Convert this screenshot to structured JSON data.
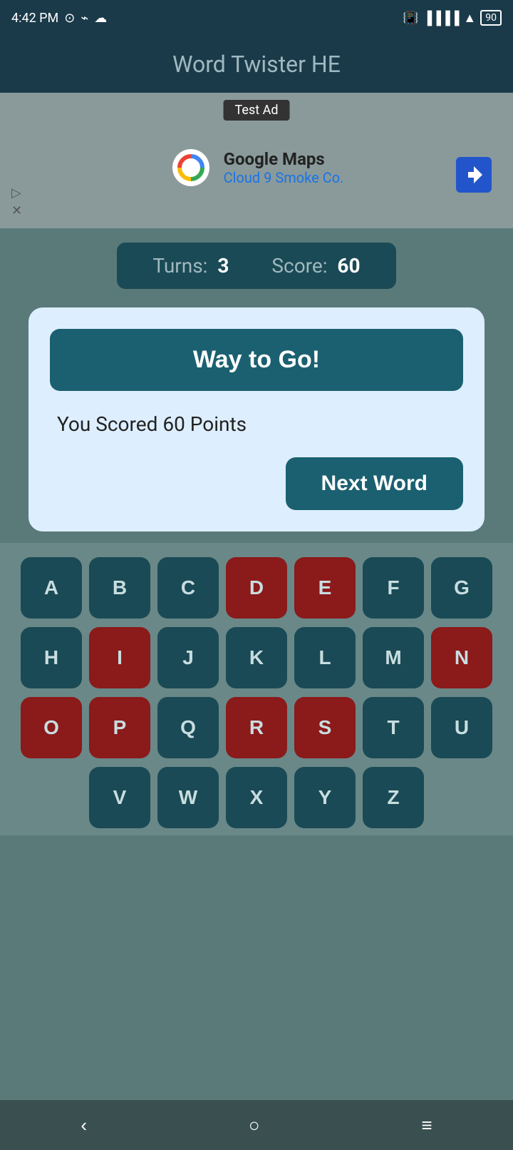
{
  "statusBar": {
    "time": "4:42 PM",
    "batteryLevel": "90"
  },
  "header": {
    "title": "Word Twister HE"
  },
  "ad": {
    "label": "Test Ad",
    "advertiser": "Google Maps",
    "location": "Cloud 9 Smoke Co."
  },
  "game": {
    "turnsLabel": "Turns:",
    "turnsValue": "3",
    "scoreLabel": "Score:",
    "scoreValue": "60"
  },
  "dialog": {
    "celebration": "Way to Go!",
    "scoredText": "You Scored 60 Points",
    "nextWordButton": "Next Word"
  },
  "keyboard": {
    "rows": [
      [
        {
          "letter": "A",
          "used": false
        },
        {
          "letter": "B",
          "used": false
        },
        {
          "letter": "C",
          "used": false
        },
        {
          "letter": "D",
          "used": true
        },
        {
          "letter": "E",
          "used": true
        },
        {
          "letter": "F",
          "used": false
        },
        {
          "letter": "G",
          "used": false
        }
      ],
      [
        {
          "letter": "H",
          "used": false
        },
        {
          "letter": "I",
          "used": true
        },
        {
          "letter": "J",
          "used": false
        },
        {
          "letter": "K",
          "used": false
        },
        {
          "letter": "L",
          "used": false
        },
        {
          "letter": "M",
          "used": false
        },
        {
          "letter": "N",
          "used": true
        }
      ],
      [
        {
          "letter": "O",
          "used": true
        },
        {
          "letter": "P",
          "used": true
        },
        {
          "letter": "Q",
          "used": false
        },
        {
          "letter": "R",
          "used": true
        },
        {
          "letter": "S",
          "used": true
        },
        {
          "letter": "T",
          "used": false
        },
        {
          "letter": "U",
          "used": false
        }
      ],
      [
        {
          "letter": "V",
          "used": false
        },
        {
          "letter": "W",
          "used": false
        },
        {
          "letter": "X",
          "used": false
        },
        {
          "letter": "Y",
          "used": false
        },
        {
          "letter": "Z",
          "used": false
        }
      ]
    ]
  },
  "navBar": {
    "backIcon": "‹",
    "homeIcon": "○",
    "menuIcon": "≡"
  }
}
